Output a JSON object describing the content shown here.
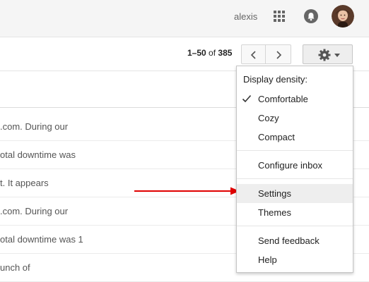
{
  "header": {
    "username": "alexis",
    "apps_icon": "apps-grid-icon",
    "notifications_icon": "notifications-icon",
    "avatar": "user-avatar"
  },
  "toolbar": {
    "pager_range": "1–50",
    "pager_of": "of",
    "pager_total": "385",
    "prev_icon": "chevron-left-icon",
    "next_icon": "chevron-right-icon",
    "settings_icon": "gear-icon"
  },
  "mail_rows": [
    ".com. During our",
    "otal downtime was",
    "t. It appears",
    ".com. During our",
    "otal downtime was 1",
    "unch of"
  ],
  "menu": {
    "header": "Display density:",
    "items": [
      {
        "label": "Comfortable",
        "checked": true
      },
      {
        "label": "Cozy"
      },
      {
        "label": "Compact"
      },
      {
        "label": "Configure inbox"
      },
      {
        "label": "Settings",
        "highlighted": true
      },
      {
        "label": "Themes"
      },
      {
        "label": "Send feedback"
      },
      {
        "label": "Help"
      }
    ]
  },
  "colors": {
    "annotation_arrow": "#e00000",
    "menu_hover": "#eeeeee"
  }
}
